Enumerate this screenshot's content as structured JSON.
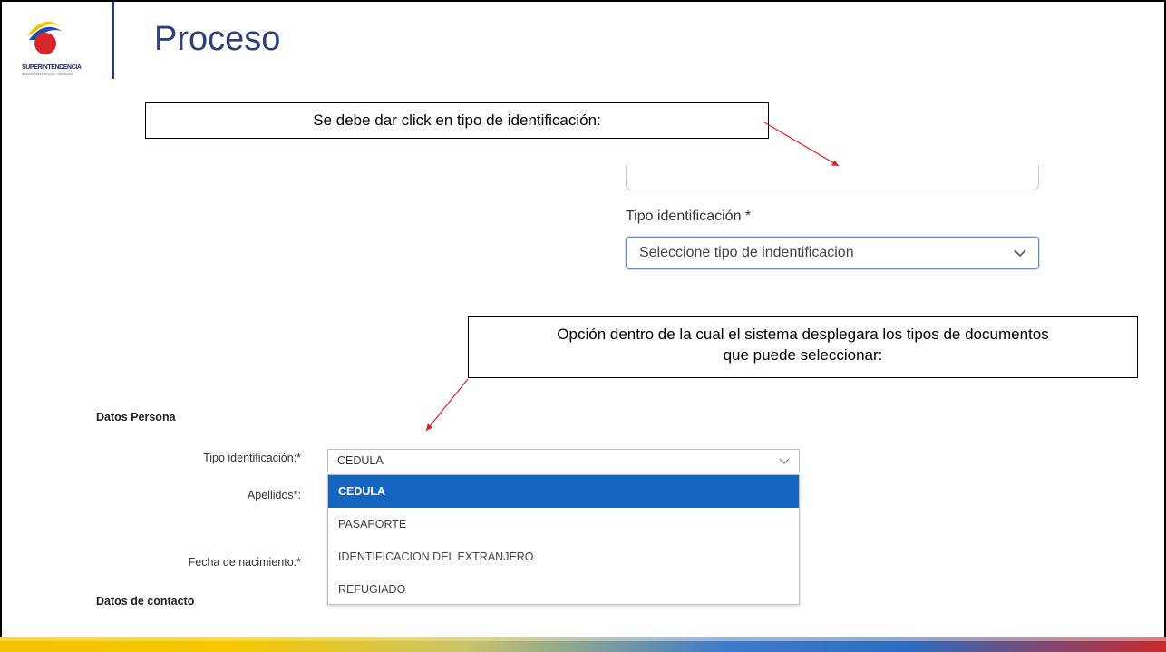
{
  "slide": {
    "title": "Proceso",
    "logo": {
      "text": "SUPERINTENDENCIA",
      "subtext": "DE ECONOMÍA POPULAR Y SOLIDARIA"
    },
    "colors": {
      "title": "#2f3f7a",
      "accent_blue": "#1565c0",
      "arrow": "#e02020",
      "bar_yellow": "#f5c800",
      "bar_blue": "#2d6cc0",
      "bar_red": "#c8282c"
    }
  },
  "callouts": {
    "first": "Se debe dar click en tipo de identificación:",
    "second_line1": "Opción dentro de la cual el sistema desplegara los tipos de documentos",
    "second_line2": "que puede seleccionar:"
  },
  "screenshot_top": {
    "field_label": "Tipo identificación *",
    "select_placeholder": "Seleccione tipo de indentificacion",
    "chevron_icon": "chevron-down-icon"
  },
  "screenshot_bottom": {
    "section_persona": "Datos Persona",
    "section_contacto": "Datos de contacto",
    "labels": {
      "tipo": "Tipo identificación:*",
      "apellidos": "Apellidos*:",
      "fecha": "Fecha de nacimiento:*"
    },
    "select_value": "CEDULA",
    "options": [
      {
        "label": "CEDULA",
        "selected": true
      },
      {
        "label": "PASAPORTE",
        "selected": false
      },
      {
        "label": "IDENTIFICACION DEL EXTRANJERO",
        "selected": false
      },
      {
        "label": "REFUGIADO",
        "selected": false
      }
    ]
  }
}
